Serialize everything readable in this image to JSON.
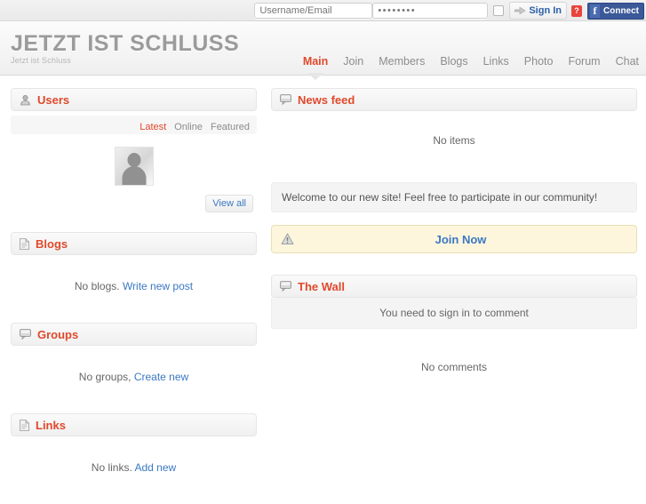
{
  "topbar": {
    "username_placeholder": "Username/Email",
    "password_value": "••••••••",
    "signin_label": "Sign In",
    "help_badge": "?",
    "facebook_label": "Connect",
    "facebook_mark": "f",
    "facebook_color": "#3b5998"
  },
  "header": {
    "logo_title": "JETZT IST SCHLUSS",
    "logo_tagline": "Jetzt ist Schluss"
  },
  "nav": {
    "items": [
      {
        "label": "Main",
        "active": true
      },
      {
        "label": "Join",
        "active": false
      },
      {
        "label": "Members",
        "active": false
      },
      {
        "label": "Blogs",
        "active": false
      },
      {
        "label": "Links",
        "active": false
      },
      {
        "label": "Photo",
        "active": false
      },
      {
        "label": "Forum",
        "active": false
      },
      {
        "label": "Chat",
        "active": false
      }
    ]
  },
  "left": {
    "users": {
      "title": "Users",
      "icon": "user-icon",
      "tabs": [
        {
          "label": "Latest",
          "active": true
        },
        {
          "label": "Online",
          "active": false
        },
        {
          "label": "Featured",
          "active": false
        }
      ],
      "view_all": "View all"
    },
    "blogs": {
      "title": "Blogs",
      "icon": "document-icon",
      "empty_text": "No blogs.",
      "link_label": "Write new post"
    },
    "groups": {
      "title": "Groups",
      "icon": "speech-bubble-icon",
      "empty_text": "No groups,",
      "link_label": "Create new"
    },
    "links": {
      "title": "Links",
      "icon": "document-icon",
      "empty_text": "No links.",
      "link_label": "Add new"
    }
  },
  "right": {
    "news_feed": {
      "title": "News feed",
      "icon": "speech-bubble-icon",
      "empty_text": "No items"
    },
    "welcome_message": "Welcome to our new site! Feel free to participate in our community!",
    "join_box": {
      "icon": "warning-triangle-icon",
      "label": "Join Now"
    },
    "wall": {
      "title": "The Wall",
      "icon": "speech-bubble-icon",
      "sign_in_note": "You need to sign in to comment",
      "empty_text": "No comments"
    }
  },
  "colors": {
    "accent_red": "#e0492c",
    "link_blue": "#3b78c3",
    "logo_gray": "#9b9b9b",
    "alert_yellow": "#fdf6dd"
  }
}
